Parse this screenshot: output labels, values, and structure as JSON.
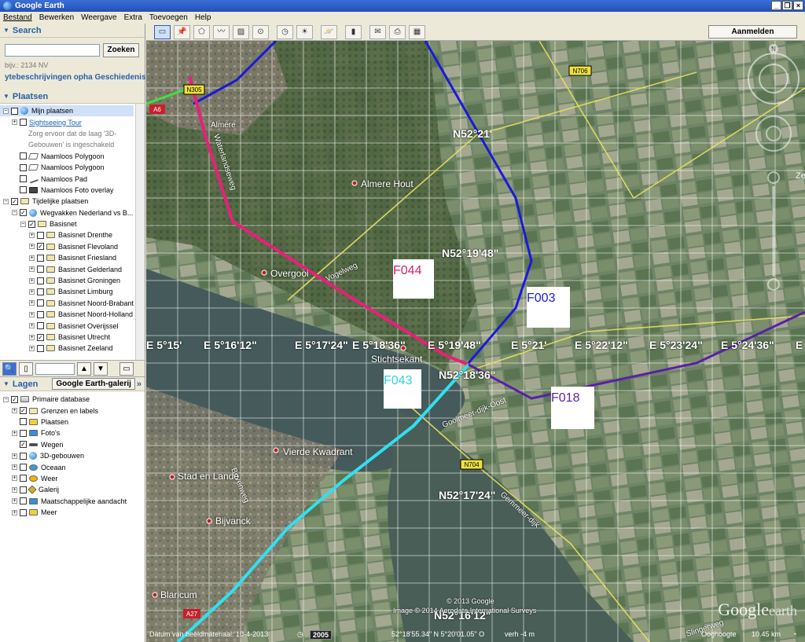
{
  "window": {
    "title": "Google Earth"
  },
  "menu": [
    "Bestand",
    "Bewerken",
    "Weergave",
    "Extra",
    "Toevoegen",
    "Help"
  ],
  "search": {
    "header": "Search",
    "button": "Zoeken",
    "hint": "bijv.: 2134 NV",
    "tabs": "уtebeschrijvingen opha Geschiedenis",
    "value": ""
  },
  "places": {
    "header": "Plaatsen",
    "items": [
      {
        "label": "Mijn plaatsen",
        "indent": 0,
        "exp": "−",
        "chk": "",
        "icon": "globe",
        "style": "sel"
      },
      {
        "label": "Sightseeing Tour",
        "indent": 1,
        "exp": "+",
        "chk": "",
        "icon": "",
        "style": "blue"
      },
      {
        "label": "Zorg ervoor dat de laag '3D-",
        "indent": 2,
        "exp": "none",
        "chk": "none",
        "icon": "",
        "style": "grey"
      },
      {
        "label": "Gebouwen' is ingeschakeld",
        "indent": 2,
        "exp": "none",
        "chk": "none",
        "icon": "",
        "style": "grey"
      },
      {
        "label": "Naamloos Polygoon",
        "indent": 1,
        "exp": "none",
        "chk": "",
        "icon": "poly",
        "style": ""
      },
      {
        "label": "Naamloos Polygoon",
        "indent": 1,
        "exp": "none",
        "chk": "",
        "icon": "poly",
        "style": ""
      },
      {
        "label": "Naamloos Pad",
        "indent": 1,
        "exp": "none",
        "chk": "",
        "icon": "path",
        "style": ""
      },
      {
        "label": "Naamloos Foto overlay",
        "indent": 1,
        "exp": "none",
        "chk": "",
        "icon": "camera",
        "style": ""
      },
      {
        "label": "Tijdelijke plaatsen",
        "indent": 0,
        "exp": "−",
        "chk": "✓",
        "icon": "folder",
        "style": ""
      },
      {
        "label": "Wegvakken Nederland vs B...",
        "indent": 1,
        "exp": "−",
        "chk": "✓",
        "icon": "globe",
        "style": ""
      },
      {
        "label": "Basisnet",
        "indent": 2,
        "exp": "−",
        "chk": "✓",
        "icon": "folder",
        "style": ""
      },
      {
        "label": "Basisnet Drenthe",
        "indent": 3,
        "exp": "+",
        "chk": "",
        "icon": "folder",
        "style": ""
      },
      {
        "label": "Basisnet Flevoland",
        "indent": 3,
        "exp": "+",
        "chk": "✓",
        "icon": "folder",
        "style": ""
      },
      {
        "label": "Basisnet Friesland",
        "indent": 3,
        "exp": "+",
        "chk": "",
        "icon": "folder",
        "style": ""
      },
      {
        "label": "Basisnet Gelderland",
        "indent": 3,
        "exp": "+",
        "chk": "",
        "icon": "folder",
        "style": ""
      },
      {
        "label": "Basisnet Groningen",
        "indent": 3,
        "exp": "+",
        "chk": "",
        "icon": "folder",
        "style": ""
      },
      {
        "label": "Basisnet Limburg",
        "indent": 3,
        "exp": "+",
        "chk": "",
        "icon": "folder",
        "style": ""
      },
      {
        "label": "Basisnet Noord-Brabant",
        "indent": 3,
        "exp": "+",
        "chk": "",
        "icon": "folder",
        "style": ""
      },
      {
        "label": "Basisnet Noord-Holland",
        "indent": 3,
        "exp": "+",
        "chk": "",
        "icon": "folder",
        "style": ""
      },
      {
        "label": "Basisnet Overijssel",
        "indent": 3,
        "exp": "+",
        "chk": "",
        "icon": "folder",
        "style": ""
      },
      {
        "label": "Basisnet Utrecht",
        "indent": 3,
        "exp": "+",
        "chk": "✓",
        "icon": "folder",
        "style": ""
      },
      {
        "label": "Basisnet Zeeland",
        "indent": 3,
        "exp": "+",
        "chk": "",
        "icon": "folder",
        "style": ""
      }
    ]
  },
  "layers": {
    "header": "Lagen",
    "gallery_button": "Google Earth-galerij",
    "gallery_arrows": "»",
    "items": [
      {
        "label": "Primaire database",
        "indent": 0,
        "exp": "−",
        "chk": "✓",
        "icon": "layers"
      },
      {
        "label": "Grenzen en labels",
        "indent": 1,
        "exp": "+",
        "chk": "✓",
        "icon": "flag"
      },
      {
        "label": "Plaatsen",
        "indent": 1,
        "exp": "none",
        "chk": "",
        "icon": "yellow"
      },
      {
        "label": "Foto's",
        "indent": 1,
        "exp": "+",
        "chk": "",
        "icon": "blue"
      },
      {
        "label": "Wegen",
        "indent": 1,
        "exp": "none",
        "chk": "✓",
        "icon": "road"
      },
      {
        "label": "3D-gebouwen",
        "indent": 1,
        "exp": "+",
        "chk": "",
        "icon": "globe"
      },
      {
        "label": "Oceaan",
        "indent": 1,
        "exp": "+",
        "chk": "",
        "icon": "ocean"
      },
      {
        "label": "Weer",
        "indent": 1,
        "exp": "+",
        "chk": "",
        "icon": "sun"
      },
      {
        "label": "Galerij",
        "indent": 1,
        "exp": "+",
        "chk": "",
        "icon": "star"
      },
      {
        "label": "Maatschappelijke aandacht",
        "indent": 1,
        "exp": "+",
        "chk": "",
        "icon": "blue"
      },
      {
        "label": "Meer",
        "indent": 1,
        "exp": "+",
        "chk": "",
        "icon": "yellow"
      }
    ]
  },
  "map": {
    "login_button": "Aanmelden",
    "places": [
      "Almere Hout",
      "Overgooi",
      "Stichtsekant",
      "Vierde Kwadrant",
      "Stad en Lande",
      "Bijvanck",
      "Blaricum",
      "Almere"
    ],
    "roads": [
      "N305",
      "A6",
      "N706",
      "N704",
      "A27",
      "Vogelweg",
      "Waterlandseweg",
      "Gooimeer-dijk-Oost",
      "Gemmeer-dijk",
      "Slingerweg",
      "Bovenweg"
    ],
    "lat_labels": [
      "N52°21'",
      "N52°19'48\"",
      "N52°18'36\"",
      "N52°17'24\"",
      "N52°16'12\""
    ],
    "lon_labels": [
      "E 5°15'",
      "E 5°16'12\"",
      "E 5°17'24\"",
      "E 5°18'36\"",
      "E 5°19'48\"",
      "E 5°21'",
      "E 5°22'12\"",
      "E 5°23'24\"",
      "E 5°24'36\"",
      "E"
    ],
    "markers": [
      "F044",
      "F003",
      "F043",
      "F018"
    ],
    "partial_label": "Ze",
    "copyright_1": "© 2013 Google",
    "copyright_2": "Image © 2014 Aerodata International Surveys",
    "logo": "Google",
    "logo_sub": "earth",
    "status": {
      "imagery_date": "Datum van beeldmateriaal: 10-4-2013",
      "year": "2005",
      "coords": "52°18'55.34\" N   5°20'01.05\" O",
      "elev": "verh    -4 m",
      "eye_alt_label": "Ooghoogte",
      "eye_alt": "10.45 km"
    },
    "colors": {
      "blue_route": "#1a1ad8",
      "pink_route": "#e8207a",
      "cyan_route": "#30e0f0",
      "purple_route": "#5a20a8",
      "green_route": "#40e040"
    }
  }
}
